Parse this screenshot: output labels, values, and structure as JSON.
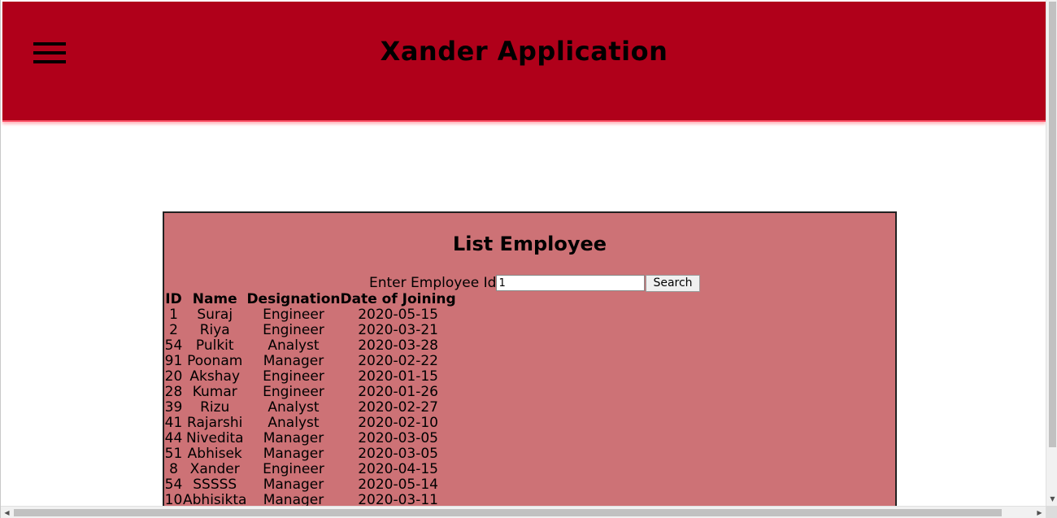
{
  "header": {
    "title": "Xander Application",
    "menu_icon": "hamburger-menu-icon",
    "background_color": "#b0001a"
  },
  "panel": {
    "title": "List Employee",
    "background_color": "#cd7276"
  },
  "search": {
    "label": "Enter Employee Id",
    "value": "1",
    "button_label": "Search"
  },
  "table": {
    "columns": [
      "ID",
      "Name",
      "Designation",
      "Date of Joining"
    ],
    "rows": [
      [
        "1",
        "Suraj",
        "Engineer",
        "2020-05-15"
      ],
      [
        "2",
        "Riya",
        "Engineer",
        "2020-03-21"
      ],
      [
        "54",
        "Pulkit",
        "Analyst",
        "2020-03-28"
      ],
      [
        "91",
        "Poonam",
        "Manager",
        "2020-02-22"
      ],
      [
        "20",
        "Akshay",
        "Engineer",
        "2020-01-15"
      ],
      [
        "28",
        "Kumar",
        "Engineer",
        "2020-01-26"
      ],
      [
        "39",
        "Rizu",
        "Analyst",
        "2020-02-27"
      ],
      [
        "41",
        "Rajarshi",
        "Analyst",
        "2020-02-10"
      ],
      [
        "44",
        "Nivedita",
        "Manager",
        "2020-03-05"
      ],
      [
        "51",
        "Abhisek",
        "Manager",
        "2020-03-05"
      ],
      [
        "8",
        "Xander",
        "Engineer",
        "2020-04-15"
      ],
      [
        "54",
        "SSSSS",
        "Manager",
        "2020-05-14"
      ],
      [
        "10",
        "Abhisikta",
        "Manager",
        "2020-03-11"
      ]
    ]
  }
}
